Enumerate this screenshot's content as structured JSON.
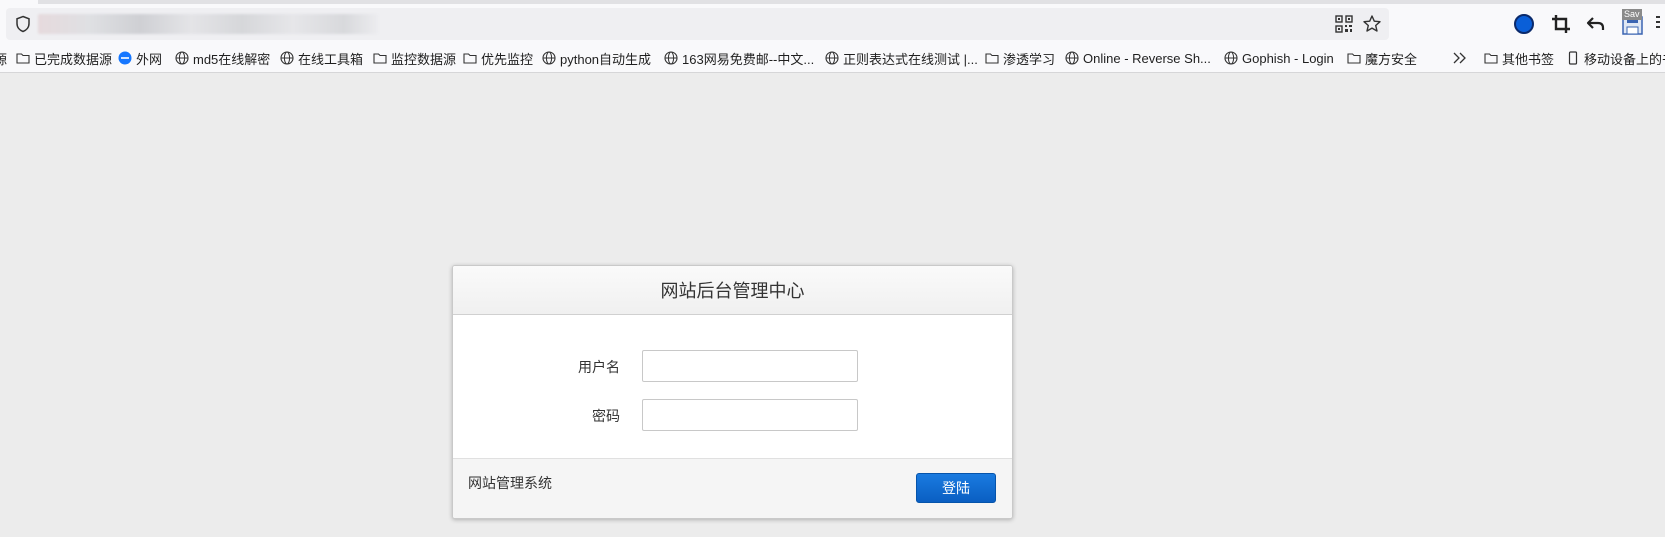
{
  "browser": {
    "url": "",
    "bookmarks": [
      {
        "label": "已完成数据源",
        "icon": "folder-icon"
      },
      {
        "label": "外网",
        "icon": "site-favicon"
      },
      {
        "label": "md5在线解密",
        "icon": "globe-icon"
      },
      {
        "label": "在线工具箱",
        "icon": "globe-icon"
      },
      {
        "label": "监控数据源",
        "icon": "folder-icon"
      },
      {
        "label": "优先监控",
        "icon": "folder-icon"
      },
      {
        "label": "python自动生成",
        "icon": "globe-icon"
      },
      {
        "label": "163网易免费邮--中文...",
        "icon": "globe-icon"
      },
      {
        "label": "正则表达式在线测试 |...",
        "icon": "globe-icon"
      },
      {
        "label": "渗透学习",
        "icon": "folder-icon"
      },
      {
        "label": "Online - Reverse Sh...",
        "icon": "globe-icon"
      },
      {
        "label": "Gophish - Login",
        "icon": "globe-icon"
      },
      {
        "label": "魔方安全",
        "icon": "folder-icon"
      },
      {
        "label": "其他书签",
        "icon": "folder-icon"
      },
      {
        "label": "移动设备上的书",
        "icon": "mobile-icon"
      }
    ],
    "extension_badge": "Sav",
    "accent_color": "#0a5fc2"
  },
  "login": {
    "title": "网站后台管理中心",
    "username_label": "用户名",
    "username_value": "",
    "password_label": "密码",
    "password_value": "",
    "footer_text": "网站管理系统",
    "submit_label": "登陆"
  }
}
